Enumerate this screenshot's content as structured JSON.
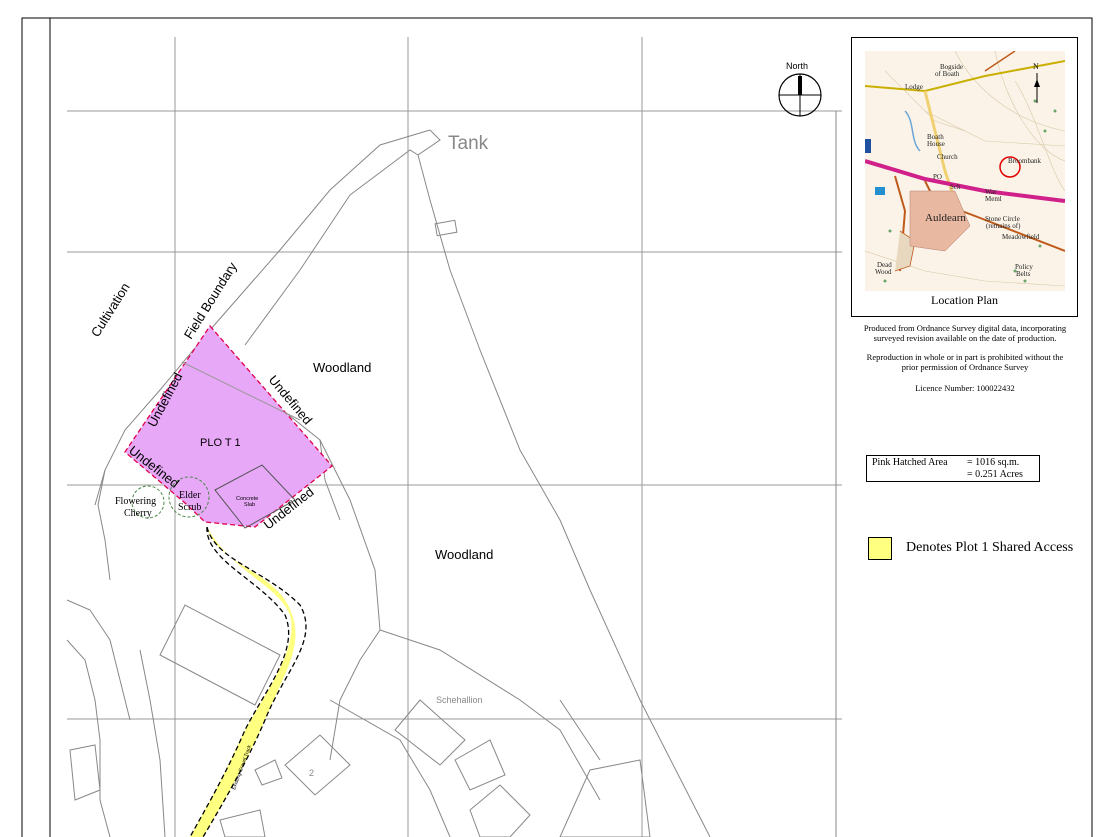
{
  "map": {
    "labels": {
      "tank": "Tank",
      "cultivation": "Cultivation",
      "field_boundary": "Field Boundary",
      "woodland_1": "Woodland",
      "woodland_2": "Woodland",
      "plot": "PLO T 1",
      "undefined_1": "Undefined",
      "undefined_2": "Undefined",
      "undefined_3": "Undefined",
      "undefined_4": "Undefined",
      "flowering_cherry_1": "Flowering",
      "flowering_cherry_2": "Cherry",
      "elder_scrub_1": "Elder",
      "elder_scrub_2": "Scrub",
      "concrete_slab_1": "Concrete",
      "concrete_slab_2": "Slab",
      "schehallion": "Schehallion",
      "house_number": "2",
      "track": "Existing Gravel Track",
      "north": "North"
    },
    "colors": {
      "plot_fill": "#e8a8f8",
      "plot_border": "#e0004a",
      "access_fill": "#ffff80",
      "lines": "#888888"
    }
  },
  "inset": {
    "caption": "Location Plan",
    "place_labels": {
      "bogside": "Bogside",
      "of_boath": "of Boath",
      "lodge": "Lodge",
      "boath": "Boath",
      "house": "House",
      "broombank": "Broombank",
      "auldearn": "Auldearn",
      "war_meml": "War",
      "meml": "Meml",
      "stone_circle": "Stone Circle",
      "remains_of": "(remains of)",
      "meadowfield": "Meadowfield",
      "dead": "Dead",
      "wood": "Wood",
      "policy": "Policy",
      "belts": "Belts",
      "po": "PO",
      "sch": "Sch",
      "church": "Church",
      "n": "N"
    }
  },
  "notes": {
    "os_line1": "Produced from Ordnance Survey digital data, incorporating",
    "os_line2": "surveyed revision available on the date of production.",
    "repro_line1": "Reproduction in whole or in part is prohibited without the",
    "repro_line2": "prior permission of Ordnance Survey",
    "licence": "Licence Number: 100022432"
  },
  "area": {
    "label": "Pink Hatched Area",
    "sqm": "= 1016 sq.m.",
    "acres": "= 0.251 Acres"
  },
  "legend": {
    "access_label": "Denotes Plot 1 Shared Access"
  }
}
